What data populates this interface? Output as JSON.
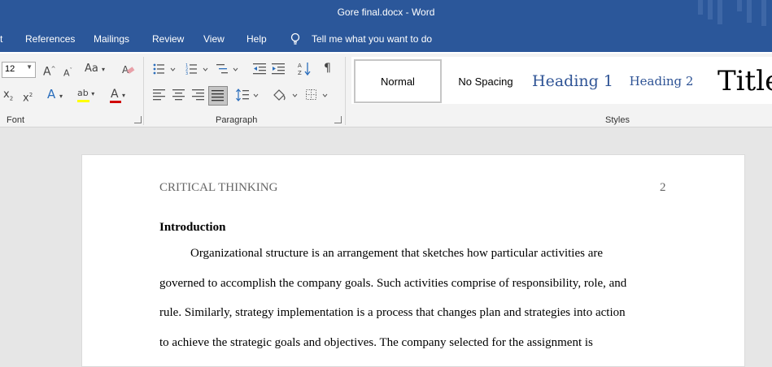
{
  "window": {
    "title": "Gore final.docx  -  Word"
  },
  "menu": {
    "tabs": [
      "t",
      "References",
      "Mailings",
      "Review",
      "View",
      "Help"
    ],
    "tell_me": "Tell me what you want to do"
  },
  "ribbon": {
    "font": {
      "group_label": "Font",
      "size_value": "12",
      "grow_font": "A",
      "shrink_font": "A",
      "change_case": "Aa",
      "subscript": "x",
      "superscript": "x",
      "text_effects": "A",
      "highlight": "ab",
      "font_color": "A",
      "highlight_color": "#ffff00",
      "font_color_bar": "#d00000"
    },
    "paragraph": {
      "group_label": "Paragraph"
    },
    "styles": {
      "group_label": "Styles",
      "items": [
        "Normal",
        "No Spacing",
        "Heading 1",
        "Heading 2",
        "Title"
      ]
    }
  },
  "document": {
    "running_head": "CRITICAL THINKING",
    "page_number": "2",
    "heading": "Introduction",
    "lines": [
      "Organizational structure is an arrangement that sketches how particular activities are",
      "governed to accomplish the company goals. Such activities comprise of responsibility, role, and",
      "rule. Similarly, strategy implementation is a process that changes plan and strategies into action",
      "to achieve the strategic goals and objectives. The company selected for the assignment is"
    ]
  },
  "colors": {
    "title_bar": "#2b579a",
    "ribbon": "#f3f3f3",
    "heading_style": "#2e5395"
  }
}
